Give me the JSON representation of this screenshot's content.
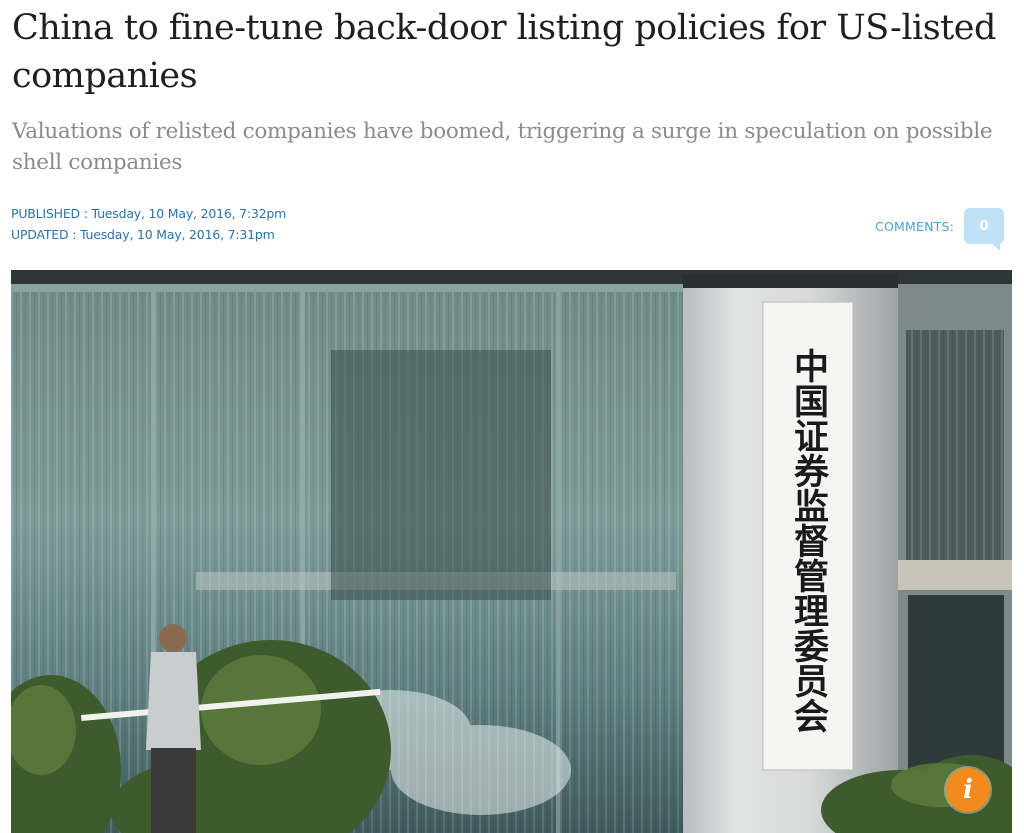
{
  "article": {
    "headline": "China to fine-tune back-door listing policies for US-listed companies",
    "subheadline": "Valuations of relisted companies have boomed, triggering a surge in speculation on possible shell companies",
    "published": "PUBLISHED : Tuesday, 10 May, 2016, 7:32pm",
    "updated": "UPDATED : Tuesday, 10 May, 2016, 7:31pm"
  },
  "comments": {
    "label": "COMMENTS:",
    "count": "0"
  },
  "photo": {
    "sign_text": "中国证券监督管理委员会",
    "info_icon": "i"
  },
  "colors": {
    "meta_link": "#2b73a8",
    "comments_label": "#4aa3d8",
    "comment_bubble": "#bfe2f6",
    "info_badge": "#f28a1e"
  }
}
